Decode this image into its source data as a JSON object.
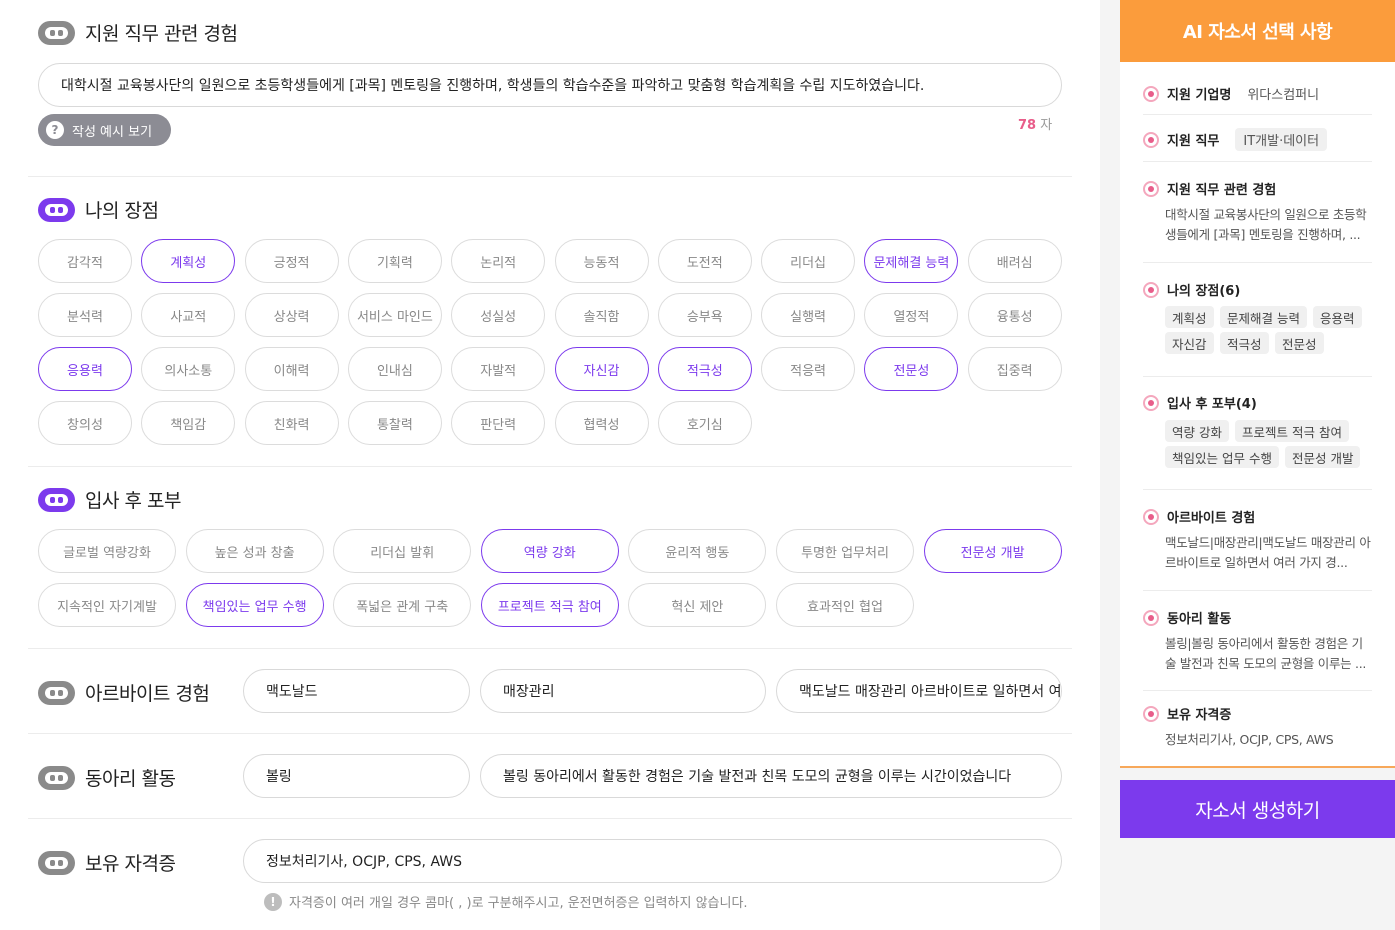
{
  "experience": {
    "title": "지원 직무 관련 경험",
    "text": "대학시절 교육봉사단의 일원으로 초등학생들에게 [과목] 멘토링을 진행하며, 학생들의 학습수준을 파악하고 맞춤형 학습계획을 수립 지도하였습니다.",
    "example_button": "작성 예시 보기",
    "char_count": "78",
    "char_unit": "자"
  },
  "strengths": {
    "title": "나의 장점",
    "chips": [
      {
        "label": "감각적",
        "selected": false
      },
      {
        "label": "계획성",
        "selected": true
      },
      {
        "label": "긍정적",
        "selected": false
      },
      {
        "label": "기획력",
        "selected": false
      },
      {
        "label": "논리적",
        "selected": false
      },
      {
        "label": "능동적",
        "selected": false
      },
      {
        "label": "도전적",
        "selected": false
      },
      {
        "label": "리더십",
        "selected": false
      },
      {
        "label": "문제해결 능력",
        "selected": true
      },
      {
        "label": "배려심",
        "selected": false
      },
      {
        "label": "분석력",
        "selected": false
      },
      {
        "label": "사교적",
        "selected": false
      },
      {
        "label": "상상력",
        "selected": false
      },
      {
        "label": "서비스 마인드",
        "selected": false
      },
      {
        "label": "성실성",
        "selected": false
      },
      {
        "label": "솔직함",
        "selected": false
      },
      {
        "label": "승부욕",
        "selected": false
      },
      {
        "label": "실행력",
        "selected": false
      },
      {
        "label": "열정적",
        "selected": false
      },
      {
        "label": "융통성",
        "selected": false
      },
      {
        "label": "응용력",
        "selected": true
      },
      {
        "label": "의사소통",
        "selected": false
      },
      {
        "label": "이해력",
        "selected": false
      },
      {
        "label": "인내심",
        "selected": false
      },
      {
        "label": "자발적",
        "selected": false
      },
      {
        "label": "자신감",
        "selected": true
      },
      {
        "label": "적극성",
        "selected": true
      },
      {
        "label": "적응력",
        "selected": false
      },
      {
        "label": "전문성",
        "selected": true
      },
      {
        "label": "집중력",
        "selected": false
      },
      {
        "label": "창의성",
        "selected": false
      },
      {
        "label": "책임감",
        "selected": false
      },
      {
        "label": "친화력",
        "selected": false
      },
      {
        "label": "통찰력",
        "selected": false
      },
      {
        "label": "판단력",
        "selected": false
      },
      {
        "label": "협력성",
        "selected": false
      },
      {
        "label": "호기심",
        "selected": false
      }
    ]
  },
  "aspirations": {
    "title": "입사 후 포부",
    "chips": [
      {
        "label": "글로벌 역량강화",
        "selected": false
      },
      {
        "label": "높은 성과 창출",
        "selected": false
      },
      {
        "label": "리더십 발휘",
        "selected": false
      },
      {
        "label": "역량 강화",
        "selected": true
      },
      {
        "label": "윤리적 행동",
        "selected": false
      },
      {
        "label": "투명한 업무처리",
        "selected": false
      },
      {
        "label": "전문성 개발",
        "selected": true
      },
      {
        "label": "지속적인 자기계발",
        "selected": false
      },
      {
        "label": "책임있는 업무 수행",
        "selected": true
      },
      {
        "label": "폭넓은 관계 구축",
        "selected": false
      },
      {
        "label": "프로젝트 적극 참여",
        "selected": true
      },
      {
        "label": "혁신 제안",
        "selected": false
      },
      {
        "label": "효과적인 협업",
        "selected": false
      }
    ]
  },
  "parttime": {
    "title": "아르바이트 경험",
    "company": "맥도날드",
    "role": "매장관리",
    "desc": "맥도날드 매장관리 아르바이트로 일하면서 여러 가지 경험을"
  },
  "club": {
    "title": "동아리 활동",
    "name": "볼링",
    "desc": "볼링 동아리에서 활동한 경험은 기술 발전과 친목 도모의 균형을 이루는 시간이었습니다"
  },
  "cert": {
    "title": "보유 자격증",
    "value": "정보처리기사, OCJP, CPS, AWS",
    "note": "자격증이 여러 개일 경우 콤마( , )로 구분해주시고, 운전면허증은 입력하지 않습니다."
  },
  "side": {
    "title": "AI 자소서 선택 사항",
    "company_label": "지원 기업명",
    "company_value": "위다스컴퍼니",
    "job_label": "지원 직무",
    "job_value": "IT개발·데이터",
    "exp_label": "지원 직무 관련 경험",
    "exp_text": "대학시절 교육봉사단의 일원으로 초등학생들에게 [과목] 멘토링을 진행하며, ...",
    "strengths_label": "나의 장점(6)",
    "strengths_tags": [
      "계획성",
      "문제해결 능력",
      "응용력",
      "자신감",
      "적극성",
      "전문성"
    ],
    "aspirations_label": "입사 후 포부(4)",
    "aspirations_tags": [
      "역량 강화",
      "프로젝트 적극 참여",
      "책임있는 업무 수행",
      "전문성 개발"
    ],
    "parttime_label": "아르바이트 경험",
    "parttime_text": "맥도날드|매장관리|맥도날드 매장관리 아르바이트로 일하면서 여러 가지 경...",
    "club_label": "동아리 활동",
    "club_text": "볼링|볼링 동아리에서 활동한 경험은 기술 발전과 친목 도모의 균형을 이루는 ...",
    "cert_label": "보유 자격증",
    "cert_text": "정보처리기사, OCJP, CPS, AWS",
    "generate_button": "자소서 생성하기"
  }
}
